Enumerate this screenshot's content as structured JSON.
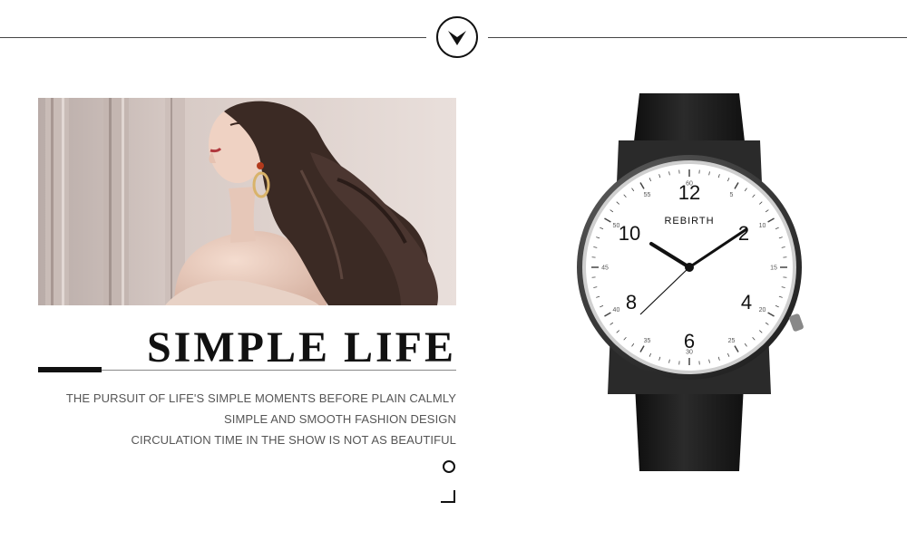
{
  "header": {
    "badge_icon": "chevron-down-icon"
  },
  "photo": {
    "subject": "woman-portrait-image"
  },
  "headline": {
    "title": "SIMPLE LIFE"
  },
  "copy": {
    "lines": [
      "THE PURSUIT OF LIFE'S SIMPLE MOMENTS BEFORE PLAIN CALMLY",
      "SIMPLE AND SMOOTH FASHION DESIGN",
      "CIRCULATION TIME IN THE SHOW IS NOT AS BEAUTIFUL"
    ]
  },
  "watch": {
    "brand": "REBIRTH",
    "hour_numerals": {
      "h12": "12",
      "h2": "2",
      "h4": "4",
      "h6": "6",
      "h8": "8",
      "h10": "10"
    },
    "minute_numerals": [
      "60",
      "5",
      "10",
      "15",
      "20",
      "25",
      "30",
      "35",
      "40",
      "45",
      "50",
      "55"
    ],
    "colors": {
      "strap": "#1a1a1a",
      "case": "#3a3a3a",
      "dial": "#ffffff"
    }
  }
}
